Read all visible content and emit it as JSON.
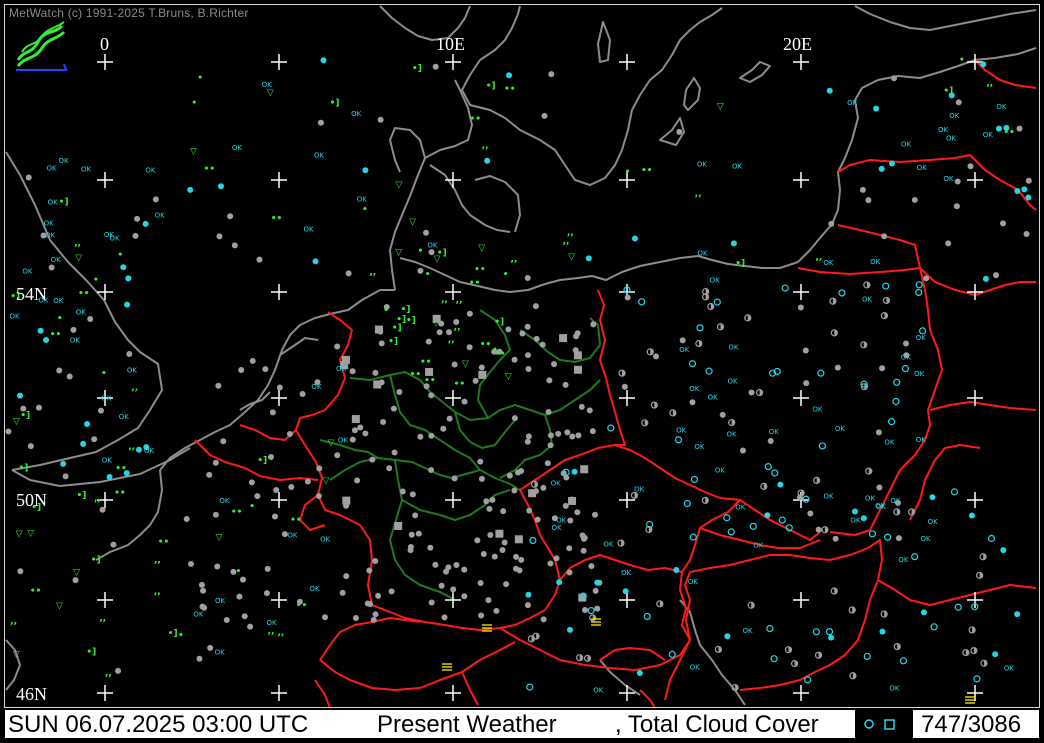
{
  "app": {
    "credit": "MetWatch  (c) 1991-2025 T.Bruns, B.Richter"
  },
  "map": {
    "longitude_labels": [
      "0",
      "10E",
      "20E"
    ],
    "latitude_labels": [
      "54N",
      "50N",
      "46N"
    ],
    "station_label": "OK",
    "colors": {
      "background": "#000000",
      "coastline": "#8c8c8c",
      "country_border": "#ff1a1a",
      "state_border": "#1f7a1f",
      "cloud_gray": "#a0a0a0",
      "cloud_cyan": "#22d8e8",
      "weather_green": "#33ee33",
      "weather_yellow": "#ffee00",
      "grid_cross": "#ffffff"
    }
  },
  "status": {
    "datetime": "SUN 06.07.2025 03:00 UTC",
    "product": "Present Weather",
    "product2": ", Total Cloud Cover",
    "count": "747/3086"
  }
}
